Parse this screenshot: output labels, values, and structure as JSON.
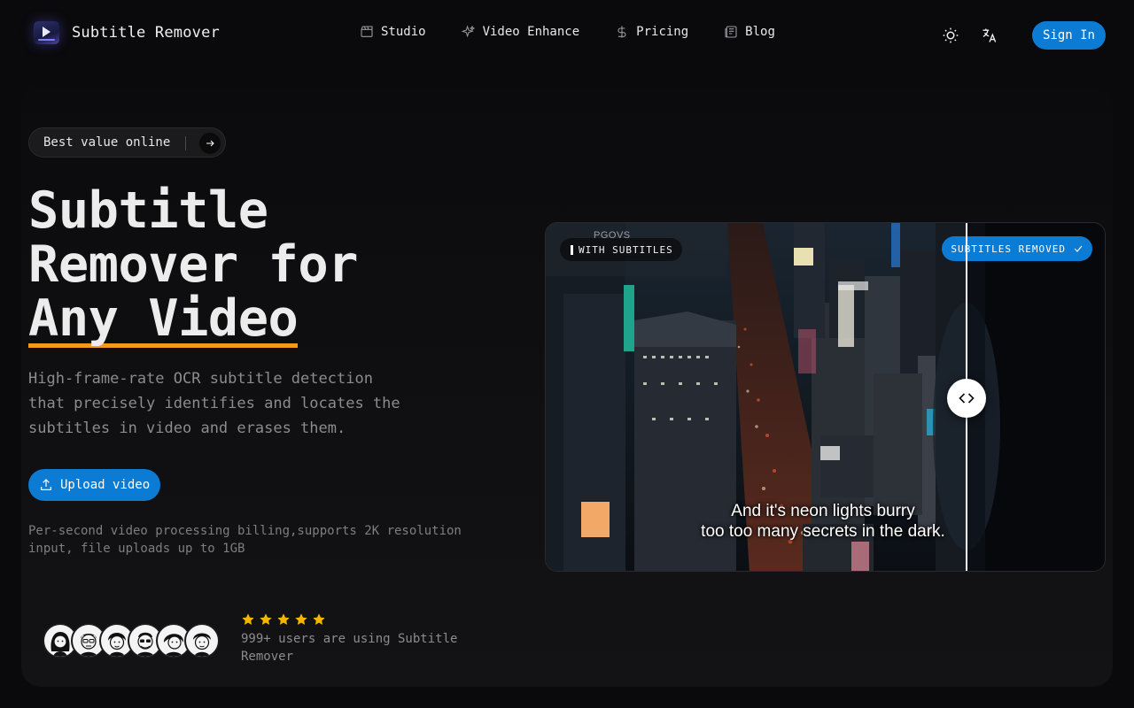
{
  "nav": {
    "brand": "Subtitle Remover",
    "links": [
      {
        "label": "Studio",
        "icon": "clapperboard-icon"
      },
      {
        "label": "Video Enhance",
        "icon": "sparkles-icon"
      },
      {
        "label": "Pricing",
        "icon": "dollar-icon"
      },
      {
        "label": "Blog",
        "icon": "newspaper-icon"
      }
    ],
    "theme_icon": "sun-icon",
    "language_icon": "translate-icon",
    "signin_label": "Sign In"
  },
  "hero": {
    "pill_label": "Best value online",
    "headline_lines": [
      "Subtitle",
      "Remover for",
      "Any Video"
    ],
    "subtitle": "High-frame-rate OCR subtitle detection that precisely identifies and locates the subtitles in video and erases them.",
    "upload_label": "Upload video",
    "note": "Per-second video processing billing,supports 2K resolution input, file uploads up to 1GB",
    "rating_stars": 5,
    "rating_text": "999+ users are using Subtitle Remover"
  },
  "compare": {
    "left_badge": "WITH SUBTITLES",
    "right_badge": "SUBTITLES REMOVED",
    "caption_line1": "And it's neon lights burry",
    "caption_line2": "too too many secrets in the dark.",
    "watermark": "PGOVS",
    "slider_position": 0.75
  },
  "colors": {
    "accent_blue": "#0b7bd4",
    "underline_orange": "#f39a1c",
    "star_yellow": "#f7b500"
  }
}
